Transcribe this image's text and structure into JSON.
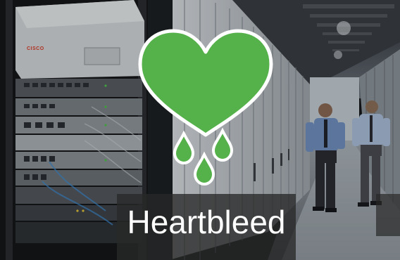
{
  "logo": {
    "icon": "bleeding-heart-icon",
    "heart_color": "#55b14a",
    "outline_color": "#ffffff"
  },
  "title": {
    "text": "Heartbleed",
    "color": "#ffffff"
  },
  "vendor_logo": {
    "text": "CISCO"
  }
}
